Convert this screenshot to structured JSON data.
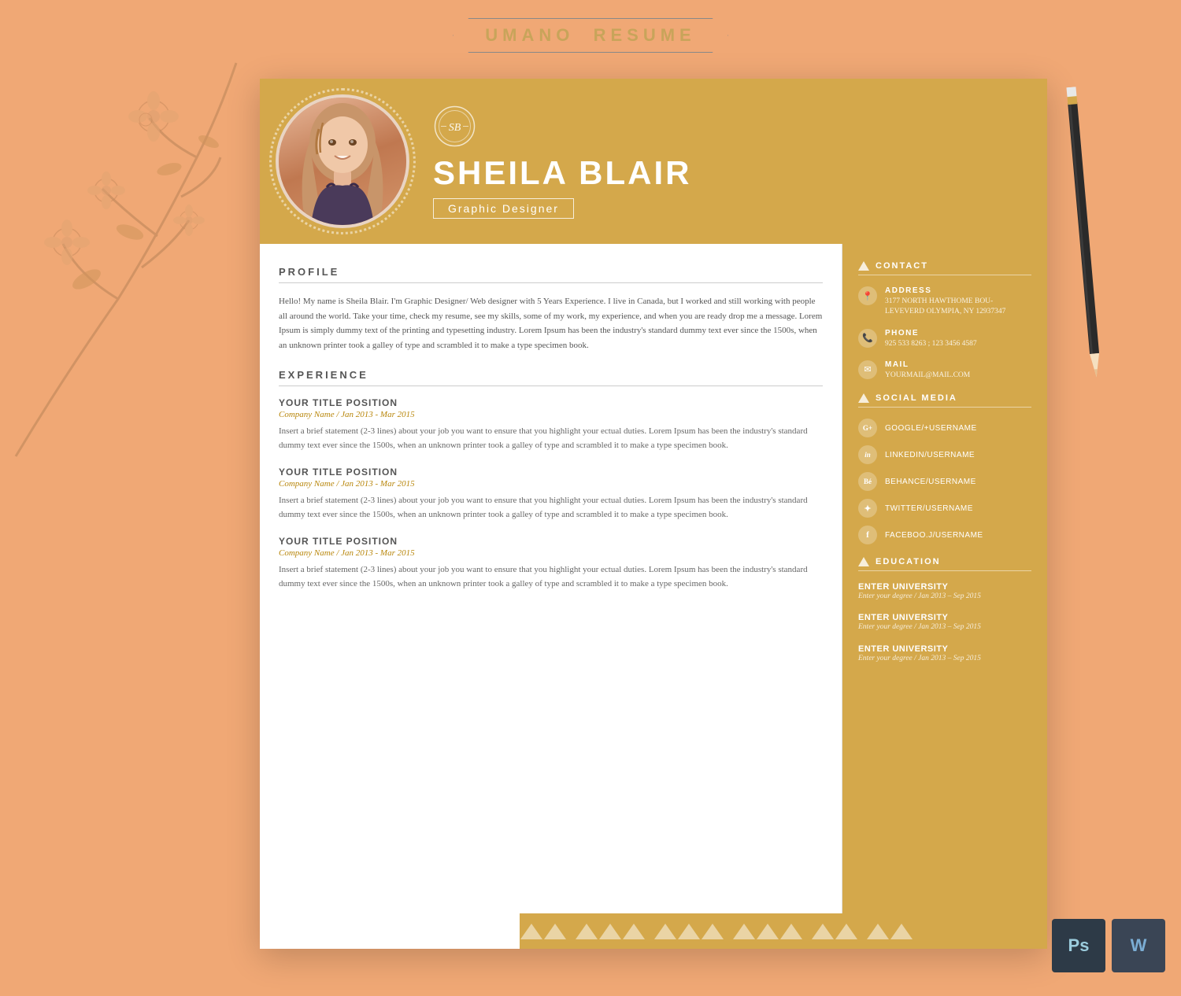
{
  "brand": {
    "title": "UMANO  RESUME",
    "title_part1": "UMANO",
    "title_part2": "RESUME"
  },
  "header": {
    "name": "SHEILA BLAIR",
    "job_title": "Graphic Designer",
    "monogram": "SB"
  },
  "profile": {
    "section_label": "PROFILE",
    "text": "Hello! My name is Sheila Blair. I'm Graphic Designer/ Web designer with 5 Years Experience. I live in Canada, but I worked and still working with people all around the world. Take your time, check my resume, see my skills, some of my work, my experience, and when you are ready drop me a message. Lorem Ipsum is simply dummy text of the printing and typesetting industry. Lorem Ipsum has been the industry's standard dummy text ever since the 1500s, when an unknown printer took a galley of type and scrambled it to make a type specimen book."
  },
  "experience": {
    "section_label": "EXPERIENCE",
    "items": [
      {
        "title": "YOUR TITLE POSITION",
        "company": "Company Name / Jan 2013 - Mar 2015",
        "desc": "Insert a brief statement (2-3 lines) about your job you want to ensure that you highlight your ectual duties. Lorem Ipsum has been the industry's standard dummy text ever since the 1500s, when an unknown printer took a galley of type and scrambled it to make a type specimen book."
      },
      {
        "title": "YOUR TITLE POSITION",
        "company": "Company Name / Jan 2013 - Mar 2015",
        "desc": "Insert a brief statement (2-3 lines) about your job you want to ensure that you highlight your ectual duties. Lorem Ipsum has been the industry's standard dummy text ever since the 1500s, when an unknown printer took a galley of type and scrambled it to make a type specimen book."
      },
      {
        "title": "YOUR TITLE POSITION",
        "company": "Company Name / Jan 2013 - Mar 2015",
        "desc": "Insert a brief statement (2-3 lines) about your job you want to ensure that you highlight your ectual duties. Lorem Ipsum has been the industry's standard dummy text ever since the 1500s, when an unknown printer took a galley of type and scrambled it to make a type specimen book."
      }
    ]
  },
  "contact": {
    "section_label": "CONTACT",
    "address_label": "ADDRESS",
    "address_value": "3177 NORTH HAWTHOME BOU-\nLEVEVERD OLYMPIA, NY 12937347",
    "phone_label": "PHONE",
    "phone_value": "925 533 8263 ; 123 3456 4587",
    "mail_label": "MAIL",
    "mail_value": "YOURMAIL@MAIL.COM"
  },
  "social": {
    "section_label": "SOCIAL MEDIA",
    "items": [
      {
        "icon": "G+",
        "text": "GOOGLE/+USERNAME"
      },
      {
        "icon": "in",
        "text": "LINKEDIN/USERNAME"
      },
      {
        "icon": "Bé",
        "text": "BEHANCE/USERNAME"
      },
      {
        "icon": "🐦",
        "text": "TWITTER/USERNAME"
      },
      {
        "icon": "f",
        "text": "FACEBOO.J/USERNAME"
      }
    ]
  },
  "education": {
    "section_label": "EDUCATION",
    "items": [
      {
        "name": "ENTER UNIVERSITY",
        "detail": "Enter your degree / Jan 2013 – Sep 2015"
      },
      {
        "name": "ENTER UNIVERSITY",
        "detail": "Enter your degree / Jan 2013 – Sep 2015"
      },
      {
        "name": "ENTER UNIVERSITY",
        "detail": "Enter your degree / Jan 2013 – Sep 2015"
      }
    ]
  },
  "apps": {
    "ps_label": "Ps",
    "w_label": "W"
  },
  "colors": {
    "gold": "#d4a84b",
    "bg": "#f0a875"
  }
}
